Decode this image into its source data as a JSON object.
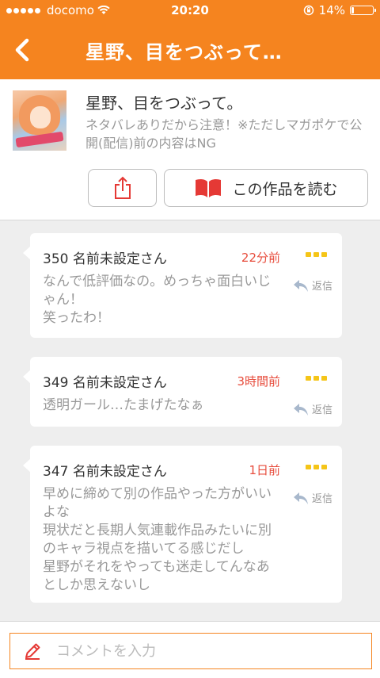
{
  "status_bar": {
    "carrier": "docomo",
    "time": "20:20",
    "battery": "14%",
    "battery_level": 0.14
  },
  "header": {
    "title": "星野、目をつぶって…"
  },
  "work": {
    "title": "星野、目をつぶって。",
    "description": "ネタバレありだから注意！※ただしマガポケで公開(配信)前の内容はNG",
    "read_button": "この作品を読む"
  },
  "comments": [
    {
      "author": "350 名前未設定さん",
      "time": "22分前",
      "body": "なんで低評価なの。めっちゃ面白いじゃん！\n笑ったわ！",
      "reply": "返信"
    },
    {
      "author": "349 名前未設定さん",
      "time": "3時間前",
      "body": "透明ガール…たまげたなぁ",
      "reply": "返信"
    },
    {
      "author": "347 名前未設定さん",
      "time": "1日前",
      "body": "早めに締めて別の作品やった方がいいよな\n現状だと長期人気連載作品みたいに別のキャラ視点を描いてる感じだし\n星野がそれをやっても迷走してんなあとしか思えないし",
      "reply": "返信"
    }
  ],
  "comment_input": {
    "placeholder": "コメントを入力"
  },
  "colors": {
    "accent": "#f5841f",
    "time_red": "#e74c3c",
    "more_yellow": "#f5c518",
    "book_red": "#e53935"
  }
}
